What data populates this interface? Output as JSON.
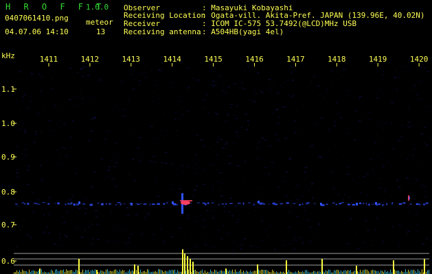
{
  "header": {
    "app_name": "H R O F F T",
    "app_version": "1.0.0",
    "filename": "0407061410.png",
    "timestamp": "04.07.06 14:10",
    "meteor_label": "meteor",
    "meteor_count": "13",
    "info": [
      {
        "label": "Observer",
        "value": ": Masayuki Kobayashi"
      },
      {
        "label": "Receiving Location",
        "value": ": Ogata-vill. Akita-Pref. JAPAN (139.96E, 40.02N)"
      },
      {
        "label": "Receiver",
        "value": ": ICOM IC-575 53.7492(@LCD)MHz USB"
      },
      {
        "label": "Receiving antenna",
        "value": ": A504HB(yagi 4el)"
      }
    ]
  },
  "spectrogram": {
    "unit_label": "kHz",
    "time_ticks": [
      "1411",
      "1412",
      "1413",
      "1414",
      "1415",
      "1416",
      "1417",
      "1418",
      "1419",
      "1420"
    ],
    "freq_ticks": [
      "1.1",
      "1.0",
      "0.9",
      "0.8",
      "0.7",
      "0.6"
    ],
    "colors": {
      "background": "#000000",
      "noise": "#101050",
      "echo_main": "#ff4060",
      "echo_weak": "#3050ff",
      "axis_text": "#ffff55",
      "level_bars": "#ffff40",
      "level_cyan": "#40e0ff",
      "guide_lines": "#a0a0a0"
    }
  }
}
